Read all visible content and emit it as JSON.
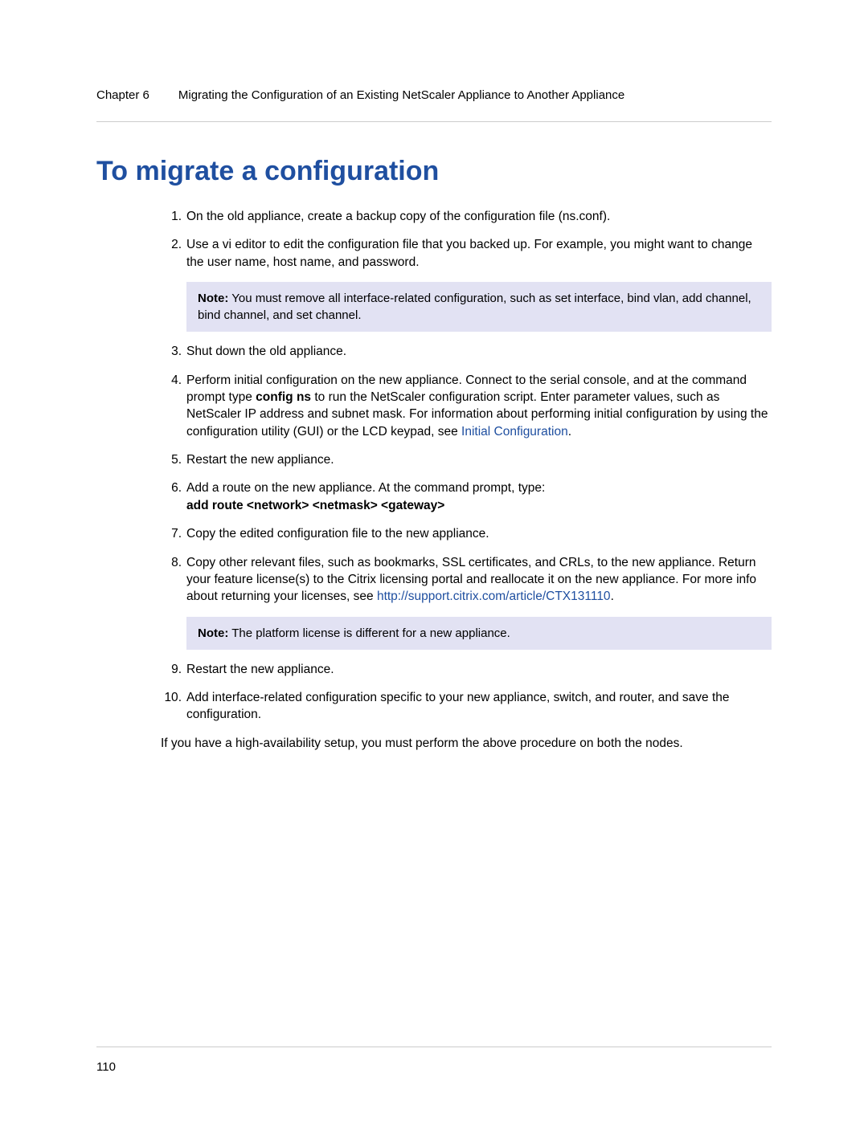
{
  "header": {
    "chapter_label": "Chapter 6",
    "chapter_title": "Migrating the Configuration of an Existing NetScaler Appliance to Another Appliance"
  },
  "heading": "To migrate a configuration",
  "steps": {
    "s1": "On the old appliance, create a backup copy of the configuration file (ns.conf).",
    "s2": "Use a vi editor to edit the configuration file that you backed up. For example, you might want to change the user name, host name, and password.",
    "s2_note_label": "Note:",
    "s2_note_text": " You must remove all interface-related configuration, such as set interface, bind vlan, add channel, bind channel, and set channel.",
    "s3": "Shut down the old appliance.",
    "s4_a": "Perform initial configuration on the new appliance. Connect to the serial console, and at the command prompt type ",
    "s4_bold": "config ns",
    "s4_b": " to run the NetScaler configuration script. Enter parameter values, such as NetScaler IP address and subnet mask. For information about performing initial configuration by using the configuration utility (GUI) or the LCD keypad, see ",
    "s4_link": "Initial Configuration",
    "s4_c": ".",
    "s5": "Restart the new appliance.",
    "s6_a": "Add a route on the new appliance. At the command prompt, type:",
    "s6_bold": "add route <network> <netmask> <gateway>",
    "s7": "Copy the edited configuration file to the new appliance.",
    "s8_a": "Copy other relevant files, such as bookmarks, SSL certificates, and CRLs, to the new appliance. Return your feature license(s) to the Citrix licensing portal and reallocate it on the new appliance. For more info about returning your licenses, see ",
    "s8_link": "http://support.citrix.com/article/CTX131110",
    "s8_b": ".",
    "s8_note_label": "Note:",
    "s8_note_text": " The platform license is different for a new appliance.",
    "s9": "Restart the new appliance.",
    "s10": "Add interface-related configuration specific to your new appliance, switch, and router, and save the configuration."
  },
  "closing": "If you have a high-availability setup, you must perform the above procedure on both the nodes.",
  "page_number": "110"
}
